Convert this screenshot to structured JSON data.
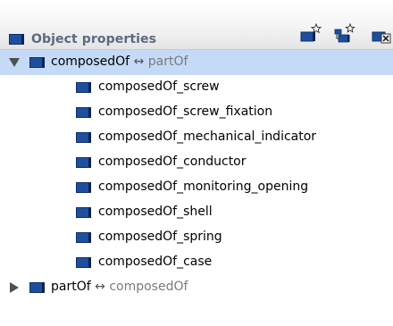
{
  "header": {
    "title": "Object properties",
    "icons": [
      "add-property-icon",
      "add-subproperty-icon",
      "delete-property-icon"
    ]
  },
  "tree": {
    "root": {
      "name": "composedOf",
      "arrow": "↔",
      "inverse": "partOf",
      "expanded": true,
      "selected": true,
      "children": [
        "composedOf_screw",
        "composedOf_screw_fixation",
        "composedOf_mechanical_indicator",
        "composedOf_conductor",
        "composedOf_monitoring_opening",
        "composedOf_shell",
        "composedOf_spring",
        "composedOf_case"
      ]
    },
    "second": {
      "name": "partOf",
      "arrow": "↔",
      "inverse": "composedOf",
      "expanded": false
    }
  },
  "colors": {
    "icon": "#1f4f9c",
    "selection": "#c5daf6",
    "header_title": "#5a6a80"
  }
}
